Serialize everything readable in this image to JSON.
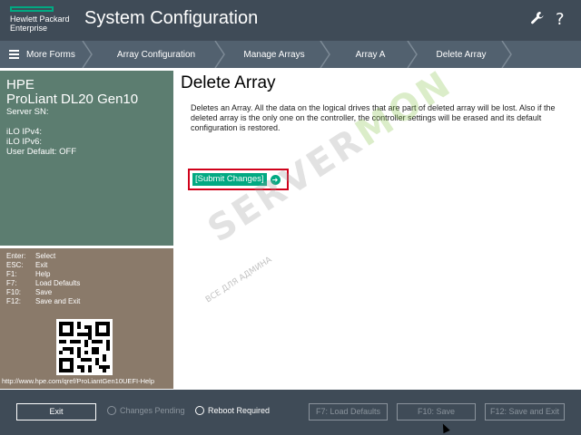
{
  "header": {
    "brand_line1": "Hewlett Packard",
    "brand_line2": "Enterprise",
    "title": "System Configuration",
    "wrench_icon": "wrench-icon",
    "help_icon": "?"
  },
  "breadcrumb": {
    "more_forms": "More Forms",
    "items": [
      {
        "label": "Array Configuration"
      },
      {
        "label": "Manage Arrays"
      },
      {
        "label": "Array A"
      },
      {
        "label": "Delete Array"
      }
    ]
  },
  "info": {
    "vendor": "HPE",
    "model": "ProLiant DL20 Gen10",
    "server_sn": "Server SN:",
    "ilo_ipv4": "iLO IPv4:",
    "ilo_ipv6": "iLO IPv6:",
    "user_default": "User Default: OFF"
  },
  "keys": [
    {
      "key": "Enter:",
      "action": "Select"
    },
    {
      "key": "ESC:",
      "action": "Exit"
    },
    {
      "key": "F1:",
      "action": "Help"
    },
    {
      "key": "F7:",
      "action": "Load Defaults"
    },
    {
      "key": "F10:",
      "action": "Save"
    },
    {
      "key": "F12:",
      "action": "Save and Exit"
    }
  ],
  "help_url": "http://www.hpe.com/qref/ProLiantGen10UEFI-Help",
  "main": {
    "title": "Delete Array",
    "description": "Deletes an Array. All the data on the logical drives that are part of deleted array will be lost. Also if the deleted array is the only one on the controller, the controller settings will be erased and its default configuration is restored.",
    "submit_label": "[Submit Changes]"
  },
  "watermark": {
    "text_a": "SERVER",
    "text_b": "MON",
    "sub": "ВСЕ ДЛЯ АДМИНА"
  },
  "footer": {
    "exit": "Exit",
    "changes_pending": "Changes Pending",
    "reboot_required": "Reboot Required",
    "f7": "F7: Load Defaults",
    "f10": "F10: Save",
    "f12": "F12: Save and Exit"
  },
  "colors": {
    "header_bg": "#3f4b57",
    "crumb_bg": "#52616f",
    "info_bg": "#5c7d70",
    "keys_bg": "#8a7a6a",
    "accent": "#01a982",
    "highlight_border": "#d0021b"
  }
}
